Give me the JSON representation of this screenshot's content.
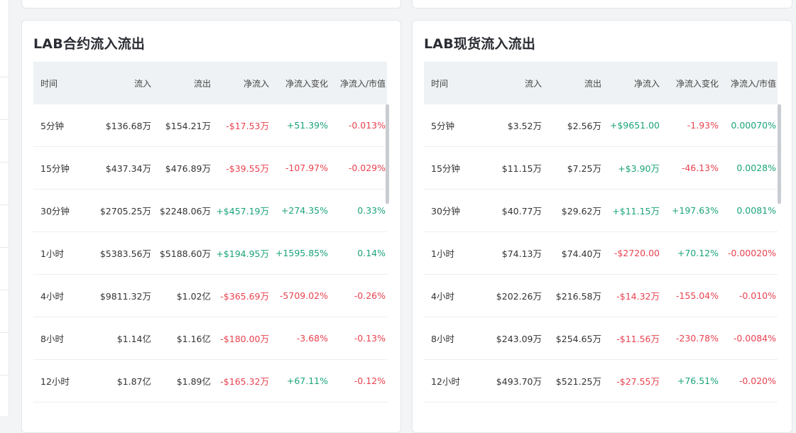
{
  "colors": {
    "up": "#1aa37a",
    "down": "#e8424f",
    "header_bg": "#eef2f4"
  },
  "headers": [
    "时间",
    "流入",
    "流出",
    "净流入",
    "净流入变化",
    "净流入/市值"
  ],
  "contract": {
    "title": "LAB合约流入流出",
    "rows": [
      {
        "time": "5分钟",
        "inflow": "$136.68万",
        "outflow": "$154.21万",
        "net": "-$17.53万",
        "net_dir": "down",
        "change": "+51.39%",
        "change_dir": "up",
        "ratio": "-0.013%",
        "ratio_dir": "down"
      },
      {
        "time": "15分钟",
        "inflow": "$437.34万",
        "outflow": "$476.89万",
        "net": "-$39.55万",
        "net_dir": "down",
        "change": "-107.97%",
        "change_dir": "down",
        "ratio": "-0.029%",
        "ratio_dir": "down"
      },
      {
        "time": "30分钟",
        "inflow": "$2705.25万",
        "outflow": "$2248.06万",
        "net": "+$457.19万",
        "net_dir": "up",
        "change": "+274.35%",
        "change_dir": "up",
        "ratio": "0.33%",
        "ratio_dir": "up"
      },
      {
        "time": "1小时",
        "inflow": "$5383.56万",
        "outflow": "$5188.60万",
        "net": "+$194.95万",
        "net_dir": "up",
        "change": "+1595.85%",
        "change_dir": "up",
        "ratio": "0.14%",
        "ratio_dir": "up"
      },
      {
        "time": "4小时",
        "inflow": "$9811.32万",
        "outflow": "$1.02亿",
        "net": "-$365.69万",
        "net_dir": "down",
        "change": "-5709.02%",
        "change_dir": "down",
        "ratio": "-0.26%",
        "ratio_dir": "down"
      },
      {
        "time": "8小时",
        "inflow": "$1.14亿",
        "outflow": "$1.16亿",
        "net": "-$180.00万",
        "net_dir": "down",
        "change": "-3.68%",
        "change_dir": "down",
        "ratio": "-0.13%",
        "ratio_dir": "down"
      },
      {
        "time": "12小时",
        "inflow": "$1.87亿",
        "outflow": "$1.89亿",
        "net": "-$165.32万",
        "net_dir": "down",
        "change": "+67.11%",
        "change_dir": "up",
        "ratio": "-0.12%",
        "ratio_dir": "down"
      }
    ]
  },
  "spot": {
    "title": "LAB现货流入流出",
    "rows": [
      {
        "time": "5分钟",
        "inflow": "$3.52万",
        "outflow": "$2.56万",
        "net": "+$9651.00",
        "net_dir": "up",
        "change": "-1.93%",
        "change_dir": "down",
        "ratio": "0.00070%",
        "ratio_dir": "up"
      },
      {
        "time": "15分钟",
        "inflow": "$11.15万",
        "outflow": "$7.25万",
        "net": "+$3.90万",
        "net_dir": "up",
        "change": "-46.13%",
        "change_dir": "down",
        "ratio": "0.0028%",
        "ratio_dir": "up"
      },
      {
        "time": "30分钟",
        "inflow": "$40.77万",
        "outflow": "$29.62万",
        "net": "+$11.15万",
        "net_dir": "up",
        "change": "+197.63%",
        "change_dir": "up",
        "ratio": "0.0081%",
        "ratio_dir": "up"
      },
      {
        "time": "1小时",
        "inflow": "$74.13万",
        "outflow": "$74.40万",
        "net": "-$2720.00",
        "net_dir": "down",
        "change": "+70.12%",
        "change_dir": "up",
        "ratio": "-0.00020%",
        "ratio_dir": "down"
      },
      {
        "time": "4小时",
        "inflow": "$202.26万",
        "outflow": "$216.58万",
        "net": "-$14.32万",
        "net_dir": "down",
        "change": "-155.04%",
        "change_dir": "down",
        "ratio": "-0.010%",
        "ratio_dir": "down"
      },
      {
        "time": "8小时",
        "inflow": "$243.09万",
        "outflow": "$254.65万",
        "net": "-$11.56万",
        "net_dir": "down",
        "change": "-230.78%",
        "change_dir": "down",
        "ratio": "-0.0084%",
        "ratio_dir": "down"
      },
      {
        "time": "12小时",
        "inflow": "$493.70万",
        "outflow": "$521.25万",
        "net": "-$27.55万",
        "net_dir": "down",
        "change": "+76.51%",
        "change_dir": "up",
        "ratio": "-0.020%",
        "ratio_dir": "down"
      }
    ]
  }
}
